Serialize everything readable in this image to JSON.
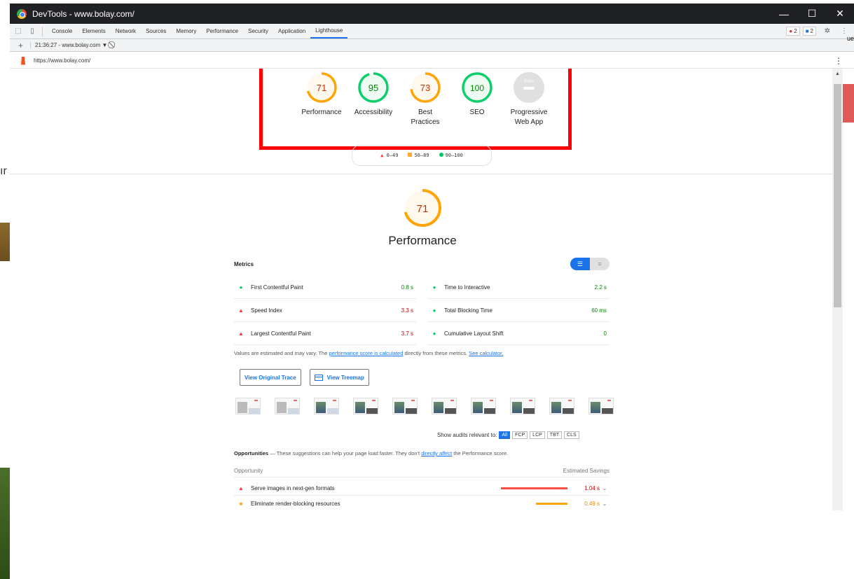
{
  "window": {
    "title": "DevTools - www.bolay.com/",
    "controls": [
      "—",
      "☐",
      "✕"
    ]
  },
  "devtools_tabs": [
    {
      "label": "Console",
      "active": false
    },
    {
      "label": "Elements",
      "active": false
    },
    {
      "label": "Network",
      "active": false
    },
    {
      "label": "Sources",
      "active": false
    },
    {
      "label": "Memory",
      "active": false
    },
    {
      "label": "Performance",
      "active": false
    },
    {
      "label": "Security",
      "active": false
    },
    {
      "label": "Application",
      "active": false
    },
    {
      "label": "Lighthouse",
      "active": true
    }
  ],
  "badges": {
    "errors": "2",
    "messages": "2"
  },
  "report_toolbar": {
    "report_label": "21:36:27 - www.bolay.com ▼"
  },
  "url": "https://www.bolay.com/",
  "side_peek": {
    "left_text": "ır",
    "right_text": "ue"
  },
  "categories": [
    {
      "score": "71",
      "value": 71,
      "label": "Performance",
      "status": "average"
    },
    {
      "score": "95",
      "value": 95,
      "label": "Accessibility",
      "status": "pass"
    },
    {
      "score": "73",
      "value": 73,
      "label": "Best Practices",
      "status": "average"
    },
    {
      "score": "100",
      "value": 100,
      "label": "SEO",
      "status": "pass"
    },
    {
      "score": "PWA",
      "value": 0,
      "label": "Progressive Web App",
      "status": "na"
    }
  ],
  "legend": {
    "fail": "0–49",
    "average": "50–89",
    "pass": "90–100"
  },
  "performance": {
    "score": "71",
    "value": 71,
    "title": "Performance"
  },
  "metrics": {
    "title": "Metrics",
    "items": [
      {
        "name": "First Contentful Paint",
        "value": "0.8 s",
        "status": "good"
      },
      {
        "name": "Time to Interactive",
        "value": "2.2 s",
        "status": "good"
      },
      {
        "name": "Speed Index",
        "value": "3.3 s",
        "status": "bad"
      },
      {
        "name": "Total Blocking Time",
        "value": "60 ms",
        "status": "good"
      },
      {
        "name": "Largest Contentful Paint",
        "value": "3.7 s",
        "status": "bad"
      },
      {
        "name": "Cumulative Layout Shift",
        "value": "0",
        "status": "good"
      }
    ],
    "note_prefix": "Values are estimated and may vary. The ",
    "note_link1": "performance score is calculated",
    "note_mid": " directly from these metrics. ",
    "note_link2": "See calculator."
  },
  "buttons": {
    "view_trace": "View Original Trace",
    "view_treemap": "View Treemap"
  },
  "audit_filter": {
    "label": "Show audits relevant to:",
    "chips": [
      "All",
      "FCP",
      "LCP",
      "TBT",
      "CLS"
    ]
  },
  "opportunities": {
    "title": "Opportunities",
    "desc_prefix": " — These suggestions can help your page load faster. They don't ",
    "desc_link": "directly affect",
    "desc_suffix": " the Performance score.",
    "col_opportunity": "Opportunity",
    "col_savings": "Estimated Savings",
    "items": [
      {
        "name": "Serve images in next-gen formats",
        "savings": "1.04 s",
        "seconds": 1.04,
        "status": "bad"
      },
      {
        "name": "Eliminate render-blocking resources",
        "savings": "0.49 s",
        "seconds": 0.49,
        "status": "average"
      }
    ]
  },
  "colors": {
    "pass": "#0cce6b",
    "average": "#ffa400",
    "fail": "#ff4e42",
    "accent": "#1a73e8",
    "highlight": "#ff0000"
  }
}
